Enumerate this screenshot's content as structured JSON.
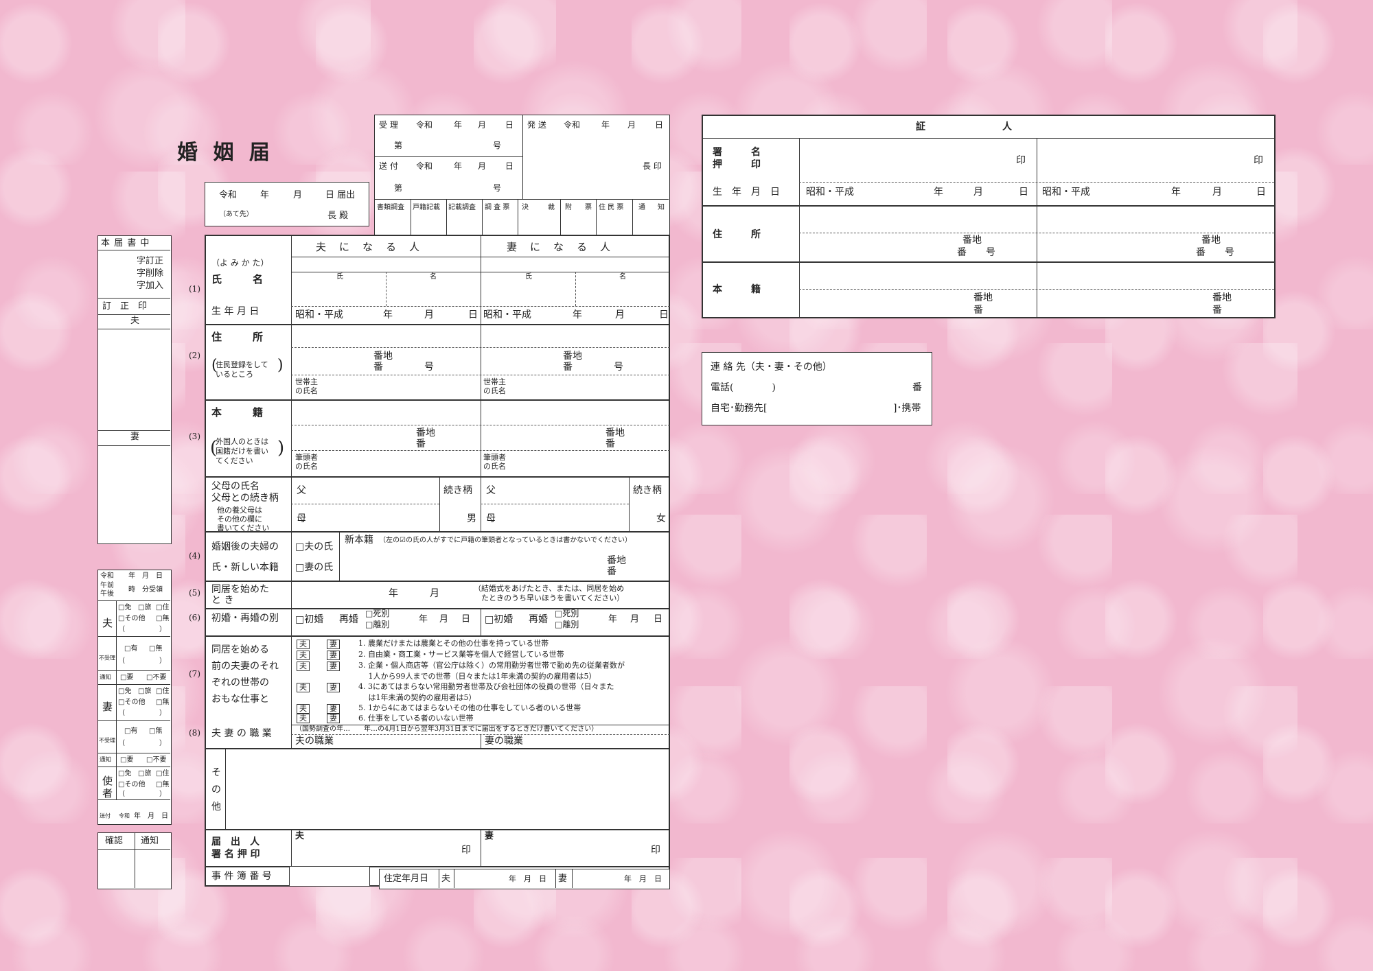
{
  "title": "婚 姻 届",
  "office": {
    "receive": "受 理",
    "send_out": "送 付",
    "dispatch": "発 送",
    "era": "令和",
    "year": "年",
    "month": "月",
    "day": "日",
    "no_prefix": "第",
    "no_suffix": "号",
    "chief_seal": "長 印",
    "columns": [
      "書類調査",
      "戸籍記載",
      "記載調査",
      "調 査 票",
      "決",
      "裁",
      "附",
      "票",
      "住 民 票",
      "通",
      "知"
    ]
  },
  "date_line": {
    "era": "令和",
    "year": "年",
    "month": "月",
    "day": "日 届出",
    "addressee_note": "（あて先）",
    "chief": "長 殿"
  },
  "side": {
    "header": "本 届 書 中",
    "corrections": [
      "字訂正",
      "字削除",
      "字加入"
    ],
    "seal": "訂　正　印",
    "husband": "夫",
    "wife": "妻",
    "reception": {
      "era": "令和",
      "ymd": "年　月　日",
      "am": "午前",
      "pm": "午後",
      "time": "時　分受領",
      "husband": "夫",
      "wife": "妻",
      "messenger": "使者",
      "opt_license": "□免",
      "opt_passport": "□旅",
      "opt_residence": "□住",
      "opt_other": "□その他",
      "opt_none": "□無",
      "paren": "（　　　　　）",
      "not_received": "不受理",
      "exists": "□有",
      "none": "□無",
      "notify": "通知",
      "need": "□要",
      "no_need": "□不要",
      "send": "送付",
      "send_era": "令和",
      "send_ymd": "年　月　日"
    },
    "confirm": "確認",
    "notice": "通知"
  },
  "main": {
    "husband_header": "夫　に　な　る　人",
    "wife_header": "妻　に　な　る　人",
    "reading": "（よ み か た）",
    "name": "氏　　　名",
    "surname": "氏",
    "given": "名",
    "birth": "生 年 月 日",
    "birth_era": "昭和・平成",
    "year": "年",
    "month": "月",
    "day": "日",
    "address": "住　　　所",
    "address_note1": "住民登録をして",
    "address_note2": "いるところ",
    "banchi": "番地",
    "ban": "番",
    "go": "号",
    "householder1": "世帯主",
    "householder2": "の氏名",
    "domicile": "本　　　籍",
    "domicile_note1": "外国人のときは",
    "domicile_note2": "国籍だけを書い",
    "domicile_note3": "てください",
    "head1": "筆頭者",
    "head2": "の氏名",
    "parents1": "父母の氏名",
    "parents2": "父母との続き柄",
    "parents_note1": "他の養父母は",
    "parents_note2": "その他の欄に",
    "parents_note3": "書いてください",
    "father": "父",
    "mother": "母",
    "relation": "続き柄",
    "male": "男",
    "female": "女",
    "row_numbers": [
      "(1)",
      "(2)",
      "(3)",
      "(4)",
      "(5)",
      "(6)",
      "(7)",
      "(8)"
    ],
    "after1": "婚姻後の夫婦の",
    "after2": "氏・新しい本籍",
    "husband_surname": "□夫の氏",
    "wife_surname": "□妻の氏",
    "new_domicile": "新本籍",
    "new_domicile_note": "（左の☑の氏の人がすでに戸籍の筆頭者となっているときは書かないでください）",
    "cohab1": "同居を始めた",
    "cohab2": "と き",
    "cohab_note1": "（結婚式をあげたとき、または、同居を始め",
    "cohab_note2": "　たときのうち早いほうを書いてください）",
    "marriage_type": "初婚・再婚の別",
    "first": "□初婚",
    "remarriage": "再婚",
    "bereaved": "□死別",
    "divorced": "□離別",
    "work_label": [
      "同居を始める",
      "前の夫妻のそれ",
      "ぞれの世帯の",
      "おもな仕事と"
    ],
    "hus_tag": "夫",
    "wife_tag": "妻",
    "work_items": [
      "1. 農業だけまたは農業とその他の仕事を持っている世帯",
      "2. 自由業・商工業・サービス業等を個人で経営している世帯",
      "3. 企業・個人商店等（官公庁は除く）の常用勤労者世帯で勤め先の従業者数が",
      "　 1人から99人までの世帯（日々または1年未満の契約の雇用者は5）",
      "4. 3にあてはまらない常用勤労者世帯及び会社団体の役員の世帯（日々また",
      "　 は1年未満の契約の雇用者は5）",
      "5. 1から4にあてはまらないその他の仕事をしている者のいる世帯",
      "6. 仕事をしている者のいない世帯"
    ],
    "occupation": "夫 妻 の 職 業",
    "census_note": "（国勢調査の年…　　年…の4月1日から翌年3月31日までに届出をするときだけ書いてください）",
    "husband_job": "夫の職業",
    "wife_job": "妻の職業",
    "other": [
      "そ",
      "の",
      "他"
    ],
    "signer1": "届　出　人",
    "signer2": "署 名 押 印",
    "seal": "印",
    "case_no": "事 件 簿 番 号",
    "residence_date": "住定年月日",
    "ymd_small": "年　月　日"
  },
  "witness": {
    "header": "証　　　　　　　　人",
    "sign1": "署　　　名",
    "sign2": "押　　　印",
    "seal": "印",
    "birth": "生　年　月　日",
    "era": "昭和・平成",
    "year": "年",
    "month": "月",
    "day": "日",
    "address": "住　　　所",
    "domicile": "本　　　籍",
    "banchi": "番地",
    "ban_go": "番　　号",
    "ban": "番"
  },
  "contact": {
    "title": "連 絡 先（夫・妻・その他）",
    "phone": "電話(　　　　)",
    "ban": "番",
    "home_work": "自宅･勤務先[",
    "mobile": "]･携帯"
  }
}
